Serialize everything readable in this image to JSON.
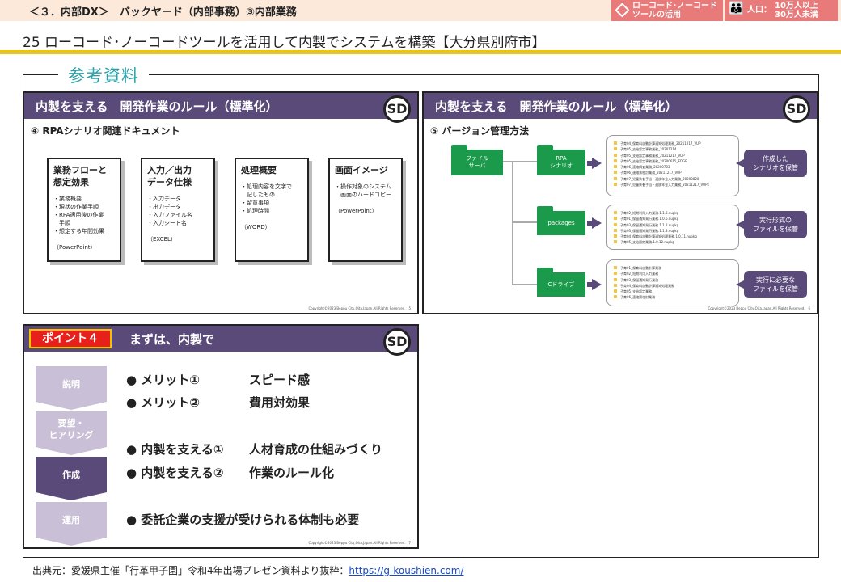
{
  "header": {
    "breadcrumb": "＜３．内部DX＞　バックヤード（内部事務）③内部業務",
    "tag_lowcode": "ローコード･ノーコード\nツールの活用",
    "tag_population_prefix": "人口：",
    "tag_population": "10万人以上\n30万人未満",
    "page_title": "25  ローコード･ノーコードツールを活用して内製でシステムを構築【大分県別府市】"
  },
  "reference_label": "参考資料",
  "logo_text": "SD",
  "slide1": {
    "title": "内製を支える　開発作業のルール（標準化）",
    "subtitle": "④ RPAシナリオ関連ドキュメント",
    "boxes": [
      {
        "title": "業務フローと\n想定効果",
        "items": [
          "・業務概要",
          "・現状の作業手順",
          "・RPA適用後の作業\n　手順",
          "・想定する年間効果"
        ],
        "note": "（PowerPoint）"
      },
      {
        "title": "入力／出力\nデータ仕様",
        "items": [
          "・入力データ",
          "・出力データ",
          "・入力ファイル名",
          "・入力シート名"
        ],
        "note": "（EXCEL）"
      },
      {
        "title": "処理概要",
        "items": [
          "・処理内容を文字で\n　記したもの",
          "・留意事項",
          "・処理時間"
        ],
        "note": "（WORD）"
      },
      {
        "title": "画面イメージ",
        "items": [
          "・操作対象のシステム\n　画面のハードコピー"
        ],
        "note": "（PowerPoint）"
      }
    ],
    "copyright": "Copyright©2023 Beppu City,Oita,Japan,All Rights Reserved.",
    "page": "5"
  },
  "slide2": {
    "title": "内製を支える　開発作業のルール（標準化）",
    "subtitle": "⑤ バージョン管理方法",
    "server_label": "ファイル\nサーバ",
    "rows": [
      {
        "folder": "RPA\nシナリオ",
        "files": [
          "子育04_保育料自動計算通知処理業務_20211217_VUP",
          "子育05_支給認定事務業務_20201214",
          "子育05_支給認定事務業務_20211217_VUP",
          "子育05_支給認定事務業務_20200615_EDGE",
          "子育06_連絡調査業務_20200703",
          "子育06_連絡票検討業務_20211217_VUP",
          "子育07_児童扶養手当・遺族年金入力業務_20200820",
          "子育07_児童扶養手当・遺族年金入力業務_20211217_VUPx"
        ],
        "bubble": "作成した\nシナリオを保管"
      },
      {
        "folder": "packages",
        "files": [
          "子育02_短期利用入力業務.1.1.3.nupkg",
          "子育01_保留通知発行業務.1.0.6.nupkg",
          "子育03_保留通知発行業務.1.1.2.nupkg",
          "子育03_保留通知発行業務.1.1.3.nupkg",
          "子育04_保育料自動計算通知処理業務.1.0.11.nupkg",
          "子育05_支給認定業務.1.0.12.nupkg"
        ],
        "bubble": "実行形式の\nファイルを保管"
      },
      {
        "folder": "Cドライブ",
        "files": [
          "子育01_保育料自動計算業務",
          "子育02_短期利用入力業務",
          "子育03_保留通知発行業務",
          "子育04_保育料自動計算通知処理業務",
          "子育05_支給認定業務",
          "子育06_連絡票検討業務"
        ],
        "bubble": "実行に必要な\nファイルを保管"
      }
    ],
    "copyright": "Copyright©2023 Beppu City,Oita,Japan,All Rights Reserved.",
    "page": "6"
  },
  "slide3": {
    "point_badge": "ポイント４",
    "title": "まずは、内製で",
    "steps": [
      "説明",
      "要望・\nヒアリング",
      "作成",
      "運用"
    ],
    "points": [
      {
        "label": "●  メリット①",
        "value": "スピード感"
      },
      {
        "label": "●  メリット②",
        "value": "費用対効果"
      },
      {
        "label": "●  内製を支える①",
        "value": "人材育成の仕組みづくり"
      },
      {
        "label": "●  内製を支える②",
        "value": "作業のルール化"
      },
      {
        "label": "●  委託企業の支援が受けられる体制も必要",
        "value": ""
      }
    ],
    "copyright": "Copyright©2023 Beppu City,Oita,Japan,All Rights Reserved.",
    "page": "7"
  },
  "source": {
    "prefix": "出典元：愛媛県主催「行革甲子園」令和4年出場プレゼン資料より抜粋：",
    "link": "https://g-koushien.com/"
  },
  "colors": {
    "slide_header": "#5a4a7a",
    "folder": "#1c9a4c",
    "accent_rule": "#f3c300",
    "tag": "#e97a7a",
    "point_badge": "#e8201c"
  }
}
